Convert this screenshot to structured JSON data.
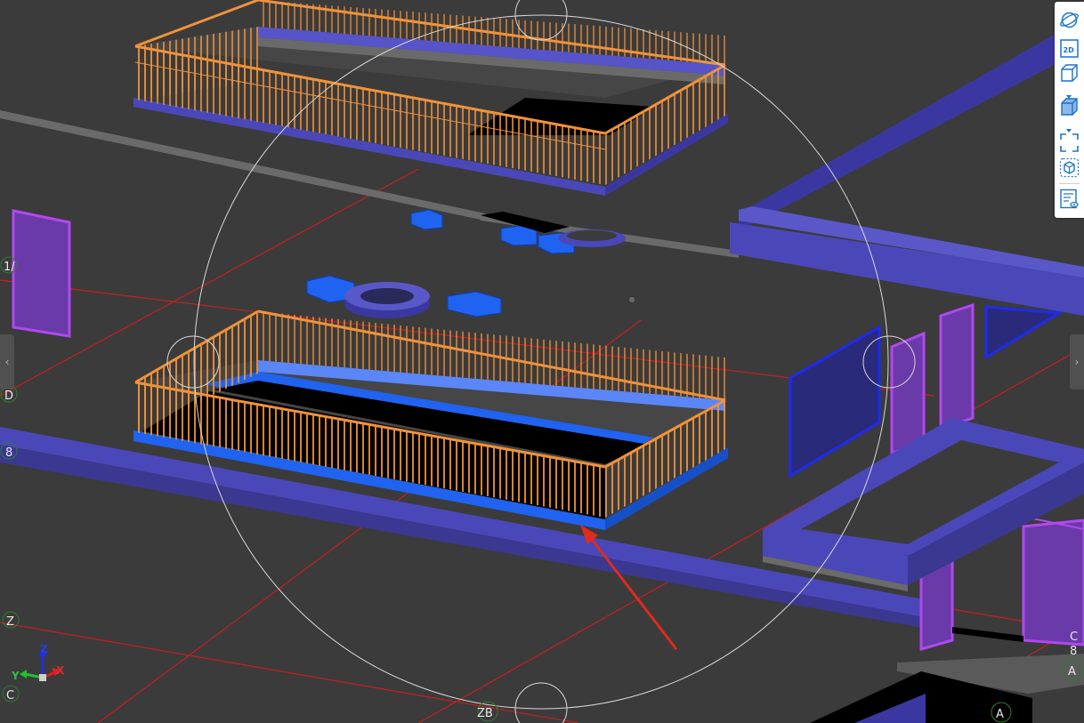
{
  "toolbar": {
    "buttons": [
      {
        "id": "orbit",
        "icon": "orbit-icon"
      },
      {
        "id": "2d",
        "icon": "view-2d-icon",
        "label": "2D"
      },
      {
        "id": "wireframe",
        "icon": "wireframe-cube-icon"
      },
      {
        "id": "shaded",
        "icon": "shaded-cube-icon"
      },
      {
        "id": "fit",
        "icon": "fit-view-icon"
      },
      {
        "id": "section",
        "icon": "section-box-icon"
      },
      {
        "id": "properties",
        "icon": "properties-panel-icon"
      }
    ]
  },
  "axes": {
    "x": "X",
    "y": "Y",
    "z": "Z"
  },
  "grid_labels": {
    "left_top": "1/",
    "left_d": "D",
    "left_8": "8",
    "left_z": "Z",
    "left_c": "C",
    "bottom_zb": "ZB",
    "right_a1": "A",
    "right_a2": "A",
    "right_c": "C",
    "right_8": "8"
  },
  "side_tabs": {
    "left": "‹",
    "right": "›"
  },
  "colors": {
    "background": "#3b3b3b",
    "railing": "#f0923a",
    "slab_blue": "#1f63f0",
    "beam_purple": "#4a48b8",
    "window_violet": "#9a46e0",
    "grid_line": "#c81e1e",
    "annotation_arrow": "#e02a1f"
  }
}
